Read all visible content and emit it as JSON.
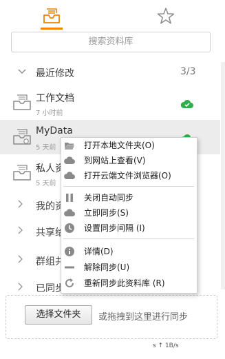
{
  "topbar": {
    "tabs": [
      {
        "icon": "inbox-tray-icon",
        "active": true
      },
      {
        "icon": "star-icon",
        "active": false
      }
    ],
    "accent": "#f08300"
  },
  "search": {
    "placeholder": "搜索资料库"
  },
  "recent": {
    "title": "最近修改",
    "count": "3/3",
    "items": [
      {
        "name": "工作文档",
        "time": "7 小时前",
        "synced": true
      },
      {
        "name": "MyData",
        "time": "5 天前",
        "synced": true
      },
      {
        "name": "私人资",
        "time": "5 天前",
        "synced": false
      }
    ]
  },
  "folders": [
    {
      "name": "我的资"
    },
    {
      "name": "共享给"
    },
    {
      "name": "群组共"
    },
    {
      "name": "已同步"
    }
  ],
  "dropzone": {
    "button_label": "选择文件夹",
    "hint": "或拖拽到这里进行同步"
  },
  "statusbar": {
    "text": "s  ↑ 1B/s"
  },
  "context_menu": {
    "groups": [
      [
        {
          "icon": "folder-open-icon",
          "label": "打开本地文件夹(O)"
        },
        {
          "icon": "cloud-icon",
          "label": "到网站上查看(V)"
        },
        {
          "icon": "cloud-icon",
          "label": "打开云端文件浏览器(O)"
        }
      ],
      [
        {
          "icon": "pause-icon",
          "label": "关闭自动同步"
        },
        {
          "icon": "cloud-icon",
          "label": "立即同步(S)"
        },
        {
          "icon": "clock-icon",
          "label": "设置同步间隔 (I)"
        }
      ],
      [
        {
          "icon": "info-icon",
          "label": "详情(D)"
        },
        {
          "icon": "minus-icon",
          "label": "解除同步(U)"
        },
        {
          "icon": "refresh-icon",
          "label": "重新同步此资料库 (R)"
        }
      ]
    ]
  },
  "colors": {
    "sync_ok": "#2fae4a",
    "icon_gray": "#8a8a8a",
    "selected_row": "#ececec"
  }
}
